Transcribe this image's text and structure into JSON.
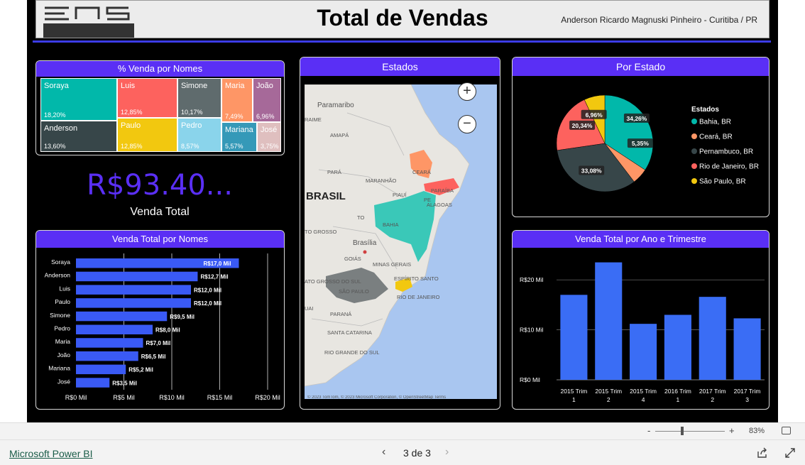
{
  "header": {
    "title": "Total de Vendas",
    "author": "Anderson Ricardo Magnuski Pinheiro - Curitiba / PR"
  },
  "treemap": {
    "title": "% Venda por Nomes",
    "tiles": [
      {
        "name": "Soraya",
        "value": "18,20%",
        "color": "#01b8aa"
      },
      {
        "name": "Anderson",
        "value": "13,60%",
        "color": "#374649"
      },
      {
        "name": "Luis",
        "value": "12,85%",
        "color": "#fd625e"
      },
      {
        "name": "Paulo",
        "value": "12,85%",
        "color": "#f2c80f"
      },
      {
        "name": "Simone",
        "value": "10,17%",
        "color": "#5f6b6d"
      },
      {
        "name": "Pedro",
        "value": "8,57%",
        "color": "#8ad4eb"
      },
      {
        "name": "Maria",
        "value": "7,49%",
        "color": "#fe9666"
      },
      {
        "name": "João",
        "value": "6,96%",
        "color": "#a66999"
      },
      {
        "name": "Mariana",
        "value": "5,57%",
        "color": "#3599b8"
      },
      {
        "name": "José",
        "value": "3,75%",
        "color": "#dfbfbf"
      }
    ]
  },
  "kpi": {
    "value": "R$93.40...",
    "label": "Venda Total"
  },
  "bar_panel": {
    "title": "Venda Total por Nomes",
    "x_ticks": [
      "R$0 Mil",
      "R$5 Mil",
      "R$10 Mil",
      "R$15 Mil",
      "R$20 Mil"
    ],
    "bar_color": "#3a5af5"
  },
  "map": {
    "title": "Estados",
    "zoom_in": "+",
    "zoom_out": "−",
    "attribution": "© 2023 TomTom, © 2023 Microsoft Corporation, © OpenStreetMap  Terms",
    "labels": [
      "Paramaribo",
      "RAIME",
      "AMAPÁ",
      "PARÁ",
      "MARANHÃO",
      "CEARÁ",
      "PIAUÍ",
      "PARAÍBA",
      "ALAGOAS",
      "BRASIL",
      "TO",
      "BAHIA",
      "TO GROSSO",
      "Brasília",
      "GOIÁS",
      "MINAS GERAIS",
      "ESPÍRITO SANTO",
      "ATO GROSSO DO SUL",
      "SÃO PAULO",
      "RIO DE JANEIRO",
      "UAI",
      "PARANÁ",
      "SANTA CATARINA",
      "RIO GRANDE DO SUL",
      "PE"
    ]
  },
  "pie_panel": {
    "title": "Por Estado",
    "legend_title": "Estados"
  },
  "column_panel": {
    "title": "Venda Total por Ano e Trimestre",
    "y_ticks": [
      "R$20 Mil",
      "R$10 Mil",
      "R$0 Mil"
    ],
    "bar_color": "#3a6df5"
  },
  "chart_data": [
    {
      "type": "bar",
      "title": "Venda Total por Nomes",
      "categories": [
        "Soraya",
        "Anderson",
        "Luis",
        "Paulo",
        "Simone",
        "Pedro",
        "Maria",
        "João",
        "Mariana",
        "José"
      ],
      "values": [
        17.0,
        12.7,
        12.0,
        12.0,
        9.5,
        8.0,
        7.0,
        6.5,
        5.2,
        3.5
      ],
      "labels": [
        "R$17,0 Mil",
        "R$12,7 Mil",
        "R$12,0 Mil",
        "R$12,0 Mil",
        "R$9,5 Mil",
        "R$8,0 Mil",
        "R$7,0 Mil",
        "R$6,5 Mil",
        "R$5,2 Mil",
        "R$3,5 Mil"
      ],
      "xlim": [
        0,
        20
      ]
    },
    {
      "type": "pie",
      "title": "Por Estado",
      "categories": [
        "Bahia, BR",
        "Ceará, BR",
        "Pernambuco, BR",
        "Rio de Janeiro, BR",
        "São Paulo, BR"
      ],
      "values": [
        34.26,
        5.35,
        33.08,
        20.34,
        6.96
      ],
      "labels": [
        "34,26%",
        "5,35%",
        "33,08%",
        "20,34%",
        "6,96%"
      ],
      "colors": [
        "#01b8aa",
        "#fe9666",
        "#374649",
        "#fd625e",
        "#f2c80f"
      ]
    },
    {
      "type": "bar",
      "title": "Venda Total por Ano e Trimestre",
      "categories": [
        "2015 Trim 1",
        "2015 Trim 2",
        "2015 Trim 4",
        "2016 Trim 1",
        "2017 Trim 2",
        "2017 Trim 3"
      ],
      "values": [
        17.0,
        23.5,
        11.2,
        13.0,
        16.6,
        12.3
      ],
      "ylim": [
        0,
        25
      ]
    }
  ],
  "footer": {
    "brand": "Microsoft Power BI",
    "pager": "3 de 3",
    "zoom": "83%"
  }
}
